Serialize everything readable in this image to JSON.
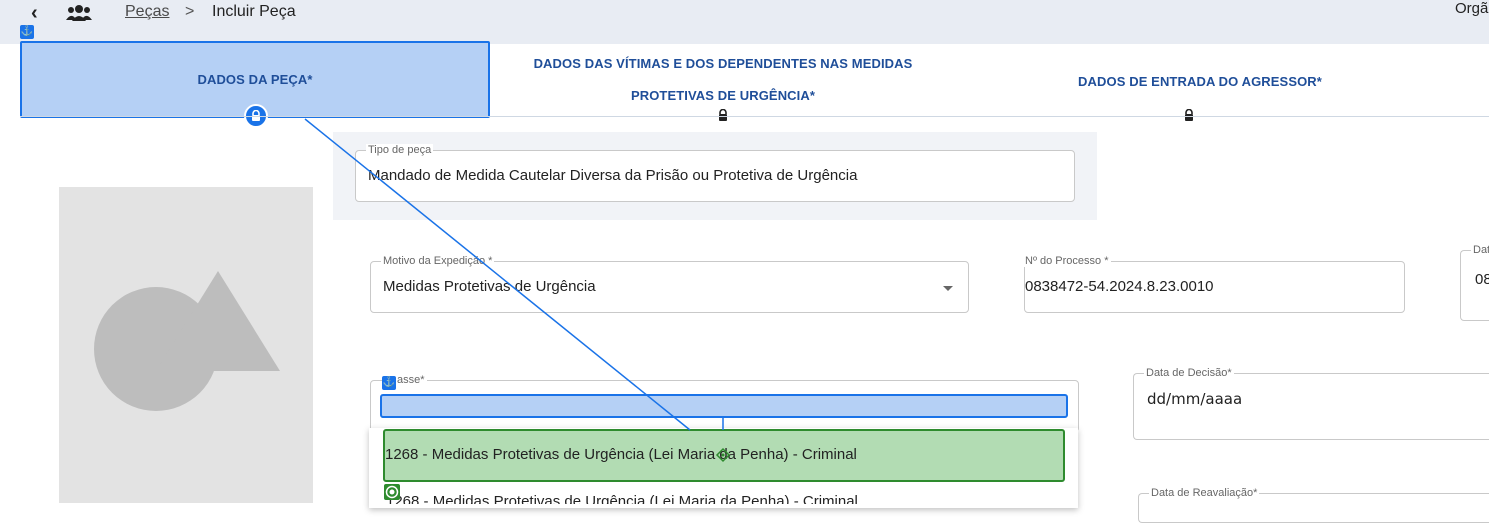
{
  "breadcrumb": {
    "back_icon": "chevron-left-icon",
    "section_icon": "users-icon",
    "link": "Peças",
    "separator": ">",
    "current": "Incluir Peça"
  },
  "org_label": "Orgã",
  "anchor_glyph": "⚓",
  "tabs": [
    {
      "label": "DADOS DA PEÇA*",
      "state": "active"
    },
    {
      "label_line1": "DADOS DAS VÍTIMAS E DOS DEPENDENTES NAS MEDIDAS",
      "label_line2": "PROTETIVAS DE URGÊNCIA*",
      "state": "locked"
    },
    {
      "label": "DADOS DE ENTRADA DO AGRESSOR*",
      "state": "locked"
    }
  ],
  "form": {
    "tipo_peca": {
      "label": "Tipo de peça",
      "value": "Mandado de Medida Cautelar Diversa da Prisão ou Protetiva de Urgência"
    },
    "motivo": {
      "label": "Motivo da Expedição *",
      "value": "Medidas Protetivas de Urgência"
    },
    "processo": {
      "label": "Nº do Processo *",
      "value": "0838472-54.2024.8.23.0010"
    },
    "data_cut": {
      "label": "Dat",
      "value": "08"
    },
    "classe": {
      "label": "Classe*",
      "label_visible": "asse*"
    },
    "data_decisao": {
      "label": "Data de Decisão*",
      "value": "dd/mm/aaaa"
    },
    "data_reavaliacao": {
      "label": "Data de Reavaliação*"
    }
  },
  "classe_options": [
    "1268 - Medidas Protetivas de Urgência (Lei Maria da Penha) - Criminal",
    "1268 - Medidas Protetivas de Urgência (Lei Maria da Penha) - Criminal"
  ],
  "colors": {
    "accent": "#1a73e8",
    "tab_text": "#1f4e99",
    "highlight_blue": "#b5d0f5",
    "highlight_green": "#b2dcb3",
    "topbar_bg": "#e8ecf3"
  }
}
